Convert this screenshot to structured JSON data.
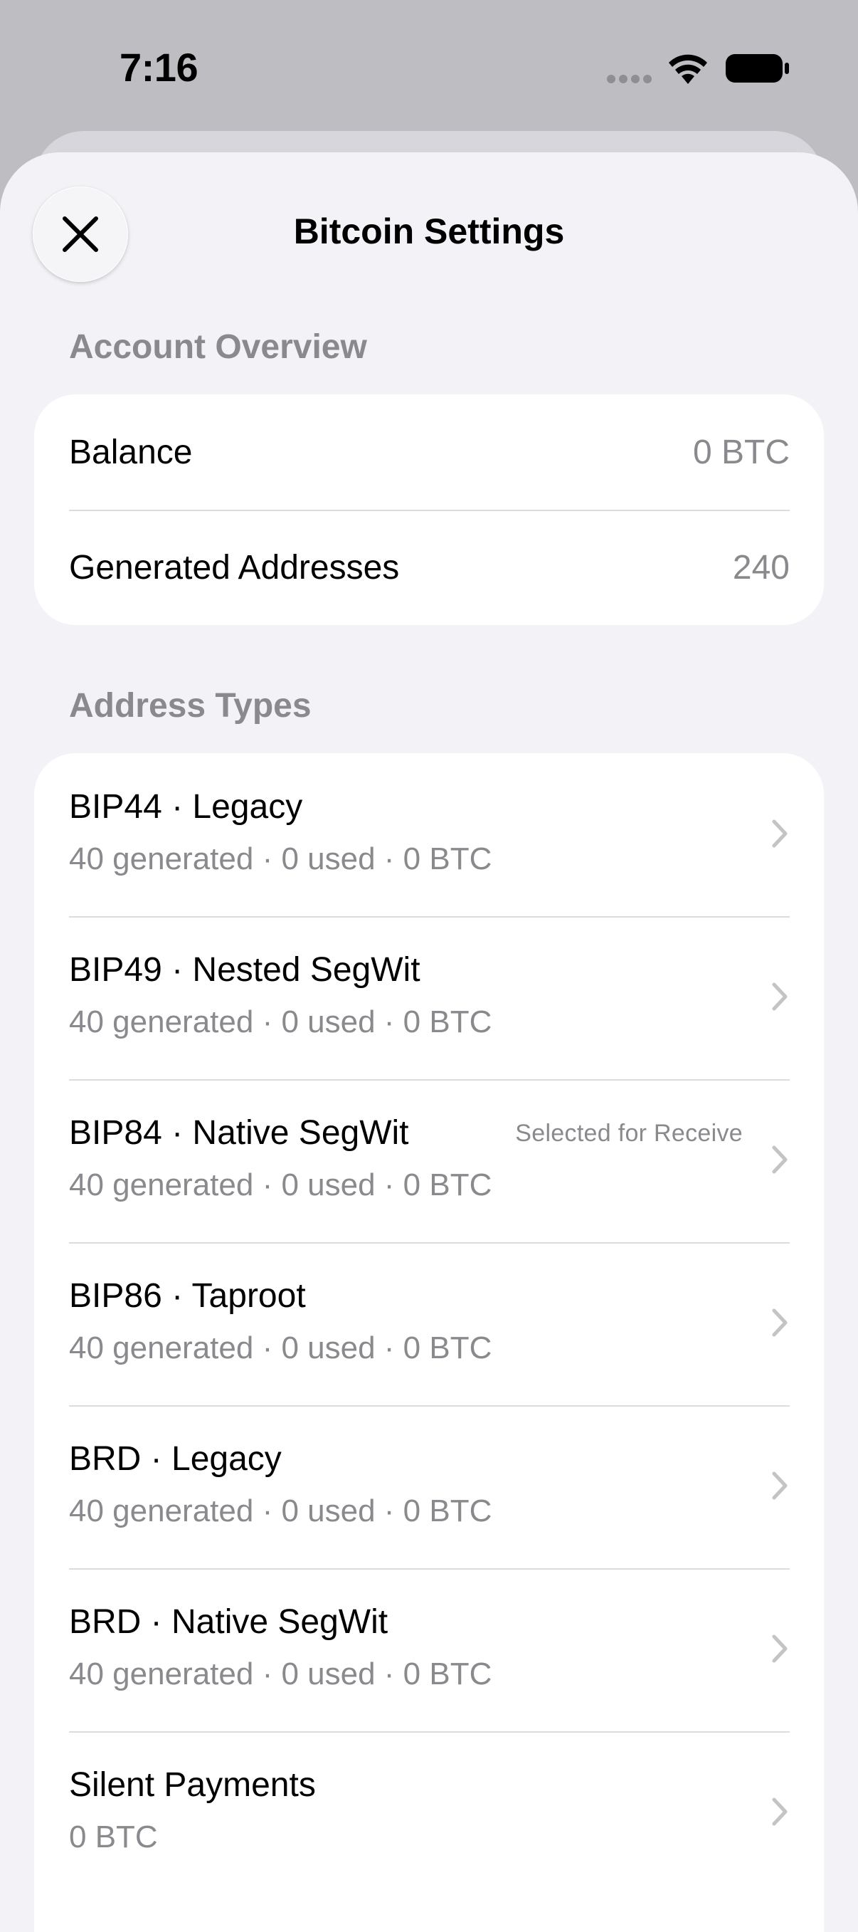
{
  "status_bar": {
    "time": "7:16"
  },
  "sheet": {
    "title": "Bitcoin Settings",
    "close_icon": "close-icon"
  },
  "account_overview": {
    "header": "Account Overview",
    "rows": [
      {
        "label": "Balance",
        "value": "0 BTC"
      },
      {
        "label": "Generated Addresses",
        "value": "240"
      }
    ]
  },
  "address_types": {
    "header": "Address Types",
    "items": [
      {
        "title": "BIP44 · Legacy",
        "subtitle": "40 generated · 0 used · 0 BTC",
        "badge": ""
      },
      {
        "title": "BIP49 · Nested SegWit",
        "subtitle": "40 generated · 0 used · 0 BTC",
        "badge": ""
      },
      {
        "title": "BIP84 · Native SegWit",
        "subtitle": "40 generated · 0 used · 0 BTC",
        "badge": "Selected for Receive"
      },
      {
        "title": "BIP86 · Taproot",
        "subtitle": "40 generated · 0 used · 0 BTC",
        "badge": ""
      },
      {
        "title": "BRD · Legacy",
        "subtitle": "40 generated · 0 used · 0 BTC",
        "badge": ""
      },
      {
        "title": "BRD · Native SegWit",
        "subtitle": "40 generated · 0 used · 0 BTC",
        "badge": ""
      },
      {
        "title": "Silent Payments",
        "subtitle": "0 BTC",
        "badge": ""
      }
    ]
  },
  "colors": {
    "background": "#f2f2f7",
    "card": "#ffffff",
    "secondary_text": "#8a8a8e",
    "separator": "#dcdce0"
  }
}
